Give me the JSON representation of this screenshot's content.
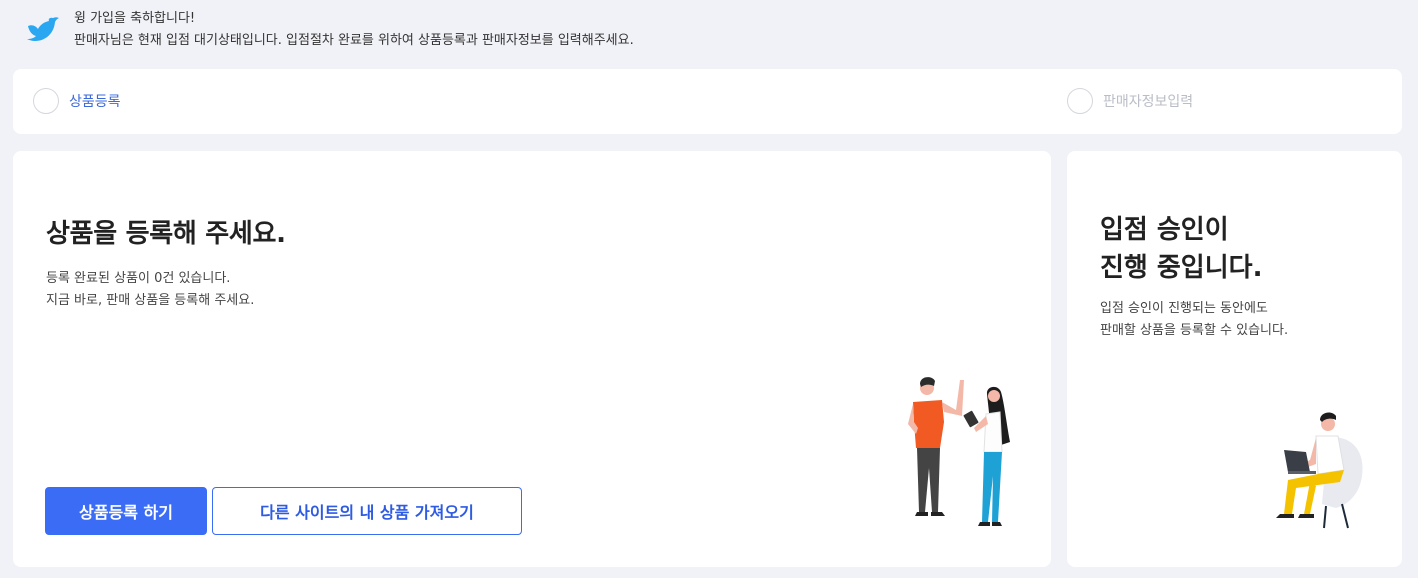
{
  "banner": {
    "line1": "윙 가입을 축하합니다!",
    "line2": "판매자님은 현재 입점 대기상태입니다. 입점절차 완료를 위하여 상품등록과 판매자정보를 입력해주세요."
  },
  "steps": [
    {
      "label": "상품등록",
      "state": "active"
    },
    {
      "label": "판매자정보입력",
      "state": "inactive"
    }
  ],
  "main_card": {
    "title": "상품을 등록해 주세요.",
    "desc_line1": "등록 완료된 상품이 0건 있습니다.",
    "desc_line2": "지금 바로, 판매 상품을 등록해 주세요.",
    "primary_button": "상품등록 하기",
    "secondary_button": "다른 사이트의 내 상품 가져오기"
  },
  "side_card": {
    "title_line1": "입점 승인이",
    "title_line2": "진행 중입니다.",
    "desc_line1": "입점 승인이 진행되는 동안에도",
    "desc_line2": "판매할 상품을 등록할 수 있습니다."
  },
  "colors": {
    "accent": "#3b6cf6",
    "active_step_text": "#3d68d8",
    "inactive_step_text": "#b9bdc6",
    "page_bg": "#f1f2f7",
    "bird": "#2aa7f0"
  }
}
